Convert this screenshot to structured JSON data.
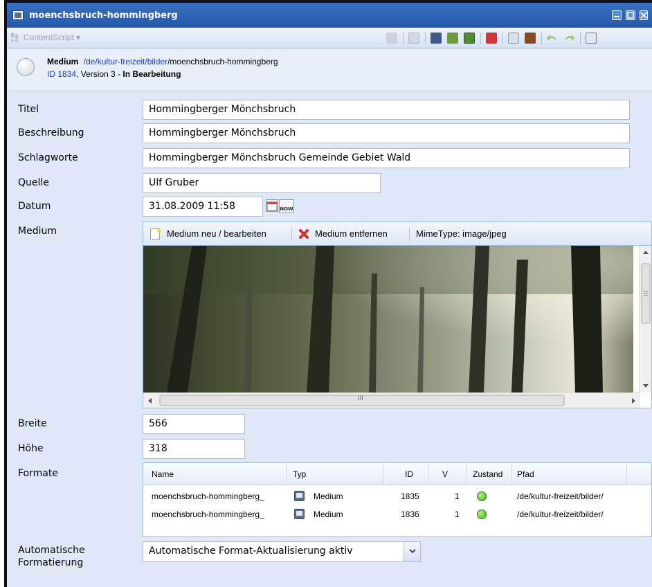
{
  "window": {
    "title": "moenchsbruch-hommingberg"
  },
  "toolbar": {
    "contentscript_label": "ContentScript ▾"
  },
  "header": {
    "type_label": "Medium",
    "path_link": "/de/kultur-freizeit/bilder",
    "path_rest": "/moenchsbruch-hommingberg",
    "id_label": "ID 1834",
    "version_text": ", Version 3 -",
    "status": "In Bearbeitung"
  },
  "form": {
    "titel": {
      "label": "Titel",
      "value": "Hommingberger Mönchsbruch"
    },
    "beschreibung": {
      "label": "Beschreibung",
      "value": "Hommingberger Mönchsbruch"
    },
    "schlagworte": {
      "label": "Schlagworte",
      "value": "Hommingberger Mönchsbruch Gemeinde Gebiet Wald"
    },
    "quelle": {
      "label": "Quelle",
      "value": "Ulf Gruber"
    },
    "datum": {
      "label": "Datum",
      "value": "31.08.2009 11:58",
      "now_label": "NOW"
    },
    "medium": {
      "label": "Medium",
      "edit_label": "Medium neu / bearbeiten",
      "remove_label": "Medium entfernen",
      "mimetype": "MimeType: image/jpeg",
      "scroll_grip": "III"
    },
    "breite": {
      "label": "Breite",
      "value": "566"
    },
    "hoehe": {
      "label": "Höhe",
      "value": "318"
    },
    "formate": {
      "label": "Formate",
      "columns": [
        "Name",
        "Typ",
        "ID",
        "V",
        "Zustand",
        "Pfad"
      ],
      "rows": [
        {
          "name": "moenchsbruch-hommingberg_",
          "typ": "Medium",
          "id": "1835",
          "v": "1",
          "zustand": "green",
          "pfad": "/de/kultur-freizeit/bilder/"
        },
        {
          "name": "moenchsbruch-hommingberg_",
          "typ": "Medium",
          "id": "1836",
          "v": "1",
          "zustand": "green",
          "pfad": "/de/kultur-freizeit/bilder/"
        }
      ]
    },
    "auto": {
      "label_line1": "Automatische",
      "label_line2": "Formatierung",
      "value": "Automatische Format-Aktualisierung aktiv"
    }
  },
  "colors": {
    "titlebar": "#2b5fae",
    "panel_bg": "#dfe8f6",
    "link": "#1a3cc8",
    "status_ok": "#3fae1e"
  }
}
